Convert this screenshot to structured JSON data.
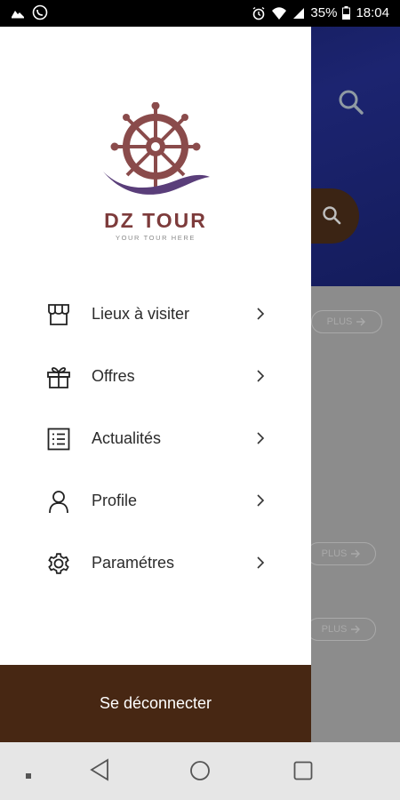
{
  "status_bar": {
    "battery": "35%",
    "time": "18:04",
    "icons": [
      "gallery-icon",
      "viber-icon",
      "alarm-icon",
      "wifi-icon",
      "signal-icon",
      "battery-icon"
    ]
  },
  "background": {
    "plus_label": "PLUS",
    "header_color": "#1c2470",
    "pill_color": "#3b2414"
  },
  "drawer": {
    "brand": {
      "name": "DZ TOUR",
      "tagline": "YOUR TOUR HERE",
      "color": "#7d3b3b"
    },
    "menu": [
      {
        "label": "Lieux à visiter",
        "icon": "store-icon"
      },
      {
        "label": "Offres",
        "icon": "gift-icon"
      },
      {
        "label": "Actualités",
        "icon": "news-list-icon"
      },
      {
        "label": "Profile",
        "icon": "person-icon"
      },
      {
        "label": "Paramétres",
        "icon": "gear-icon"
      }
    ],
    "logout_label": "Se déconnecter",
    "logout_color": "#472713"
  },
  "nav_bar": {
    "icons": [
      "recents-dot-icon",
      "back-icon",
      "home-icon",
      "overview-icon"
    ]
  }
}
